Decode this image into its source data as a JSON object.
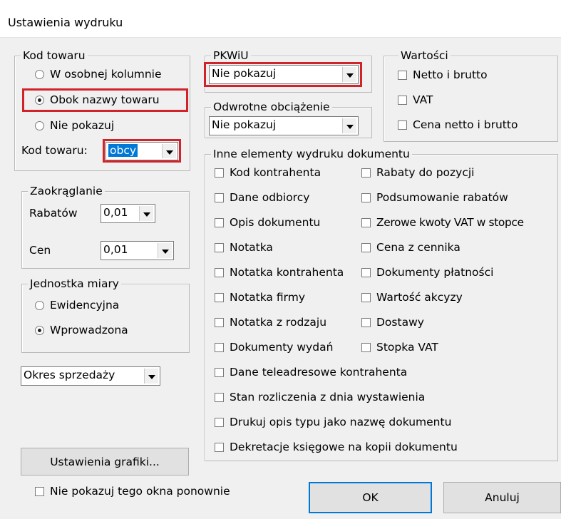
{
  "window": {
    "title": "Ustawienia wydruku"
  },
  "kod_towaru": {
    "legend": "Kod towaru",
    "options": [
      "W osobnej kolumnie",
      "Obok nazwy towaru",
      "Nie pokazuj"
    ],
    "selected": "Obok nazwy towaru",
    "combo_label": "Kod towaru:",
    "combo_value": "obcy"
  },
  "zaokraglanie": {
    "legend": "Zaokrąglanie",
    "rabatow_label": "Rabatów",
    "rabatow_value": "0,01",
    "cen_label": "Cen",
    "cen_value": "0,01"
  },
  "jednostka": {
    "legend": "Jednostka miary",
    "options": [
      "Ewidencyjna",
      "Wprowadzona"
    ],
    "selected": "Wprowadzona"
  },
  "okres": {
    "value": "Okres sprzedaży"
  },
  "pkwiu": {
    "legend": "PKWiU",
    "value": "Nie pokazuj"
  },
  "odwrotne": {
    "legend": "Odwrotne obciążenie",
    "value": "Nie pokazuj"
  },
  "wartosci": {
    "legend": "Wartości",
    "items": [
      "Netto i brutto",
      "VAT",
      "Cena netto i brutto"
    ]
  },
  "inne": {
    "legend": "Inne elementy wydruku dokumentu",
    "left": [
      "Kod kontrahenta",
      "Dane odbiorcy",
      "Opis dokumentu",
      "Notatka",
      "Notatka kontrahenta",
      "Notatka firmy",
      "Notatka z rodzaju",
      "Dokumenty wydań"
    ],
    "right": [
      "Rabaty do pozycji",
      "Podsumowanie rabatów",
      "Zerowe kwoty VAT w stopce",
      "Cena z cennika",
      "Dokumenty płatności",
      "Wartość akcyzy",
      "Dostawy",
      "Stopka VAT"
    ],
    "wide": [
      "Dane teleadresowe kontrahenta",
      "Stan rozliczenia z dnia wystawienia",
      "Drukuj opis typu jako nazwę dokumentu",
      "Dekretacje księgowe na kopii dokumentu"
    ]
  },
  "buttons": {
    "grafika": "Ustawienia grafiki...",
    "ok": "OK",
    "anuluj": "Anuluj"
  },
  "footer": {
    "nie_pokazuj": "Nie pokazuj tego okna ponownie"
  },
  "colors": {
    "highlight_border": "#d2232a",
    "selection": "#0078d7"
  }
}
